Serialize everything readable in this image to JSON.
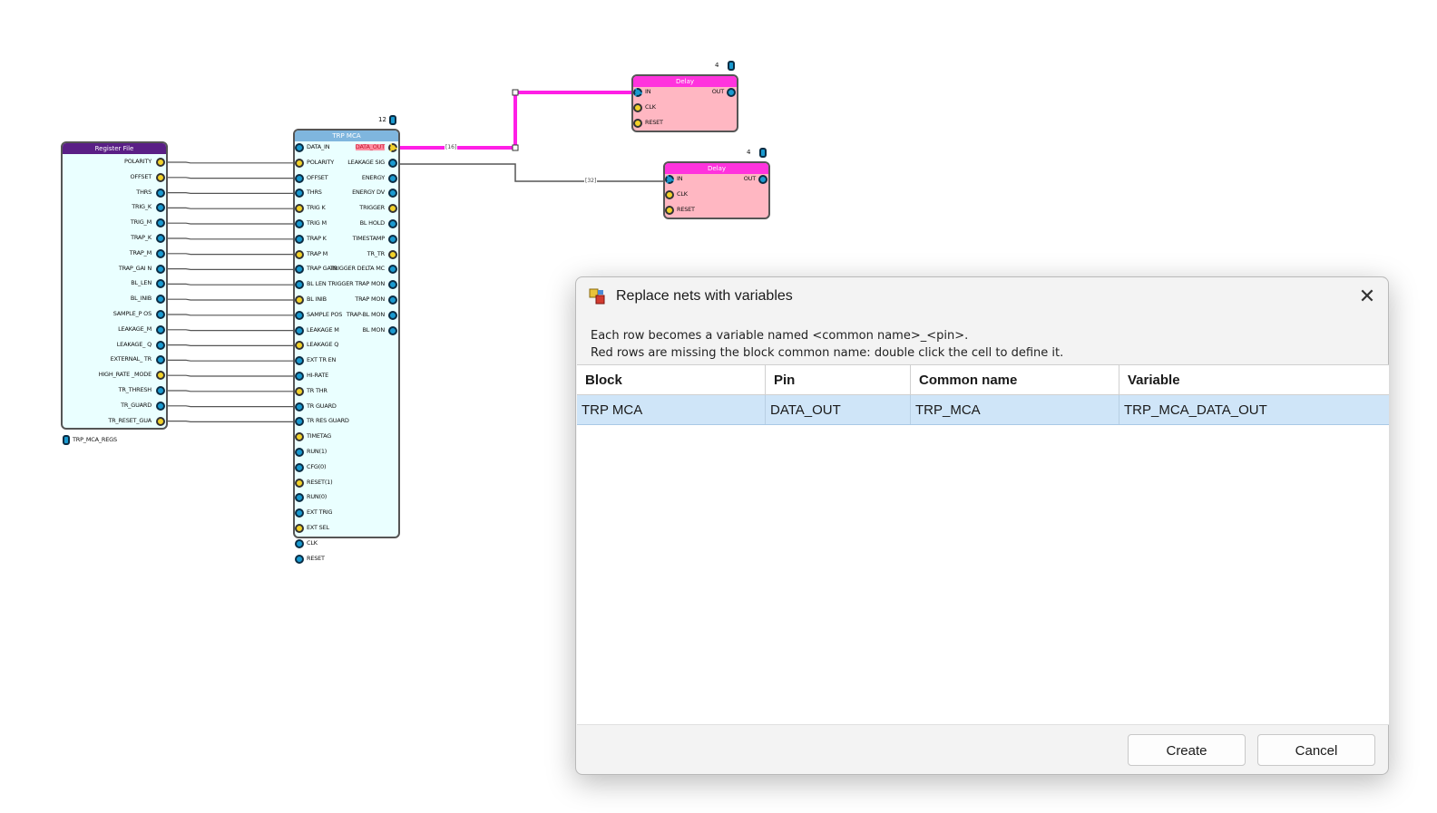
{
  "schematic": {
    "register_file": {
      "title": "Register File",
      "pins": [
        "POLARITY",
        "OFFSET",
        "THRS",
        "TRIG_K",
        "TRIG_M",
        "TRAP_K",
        "TRAP_M",
        "TRAP_GAI N",
        "BL_LEN",
        "BL_INIB",
        "SAMPLE_P OS",
        "LEAKAGE_M",
        "LEAKAGE_ Q",
        "EXTERNAL_ TR",
        "HIGH_RATE _MODE",
        "TR_THRESH",
        "TR_GUARD",
        "TR_RESET_GUA"
      ],
      "name": "TRP_MCA_REGS"
    },
    "mca": {
      "title": "TRP MCA",
      "count": "12",
      "inputs": [
        "DATA_IN",
        "POLARITY",
        "OFFSET",
        "THRS",
        "TRIG K",
        "TRIG M",
        "TRAP K",
        "TRAP M",
        "TRAP GAIN",
        "BL LEN",
        "BL INIB",
        "SAMPLE POS",
        "LEAKAGE M",
        "LEAKAGE Q",
        "EXT TR EN",
        "HI-RATE",
        "TR THR",
        "TR GUARD",
        "TR RES GUARD",
        "TIMETAG",
        "RUN(1)",
        "CFG(0)",
        "RESET(1)",
        "RUN(0)",
        "EXT TRIG",
        "EXT SEL",
        "CLK",
        "RESET"
      ],
      "outputs": [
        "DATA_OUT",
        "LEAKAGE SIG",
        "ENERGY",
        "ENERGY DV",
        "TRIGGER",
        "BL HOLD",
        "TIMESTAMP",
        "TR_TR",
        "TRIGGER DELTA MC",
        "TRIGGER TRAP MON",
        "TRAP MON",
        "TRAP-BL MON",
        "BL MON"
      ]
    },
    "delay1": {
      "title": "Delay",
      "count": "4",
      "pins": [
        "IN",
        "CLK",
        "RESET"
      ],
      "out": "OUT"
    },
    "delay2": {
      "title": "Delay",
      "count": "4",
      "pins": [
        "IN",
        "CLK",
        "RESET"
      ],
      "out": "OUT"
    },
    "bus_labels": {
      "data_out": "[16]",
      "leakage": "[32]"
    }
  },
  "dialog": {
    "title": "Replace nets with variables",
    "description_line1": "Each row becomes a variable named <common name>_<pin>.",
    "description_line2": "Red rows are missing the block common name: double click the cell to define it.",
    "columns": [
      "Block",
      "Pin",
      "Common name",
      "Variable"
    ],
    "rows": [
      [
        "TRP MCA",
        "DATA_OUT",
        "TRP_MCA",
        "TRP_MCA_DATA_OUT"
      ]
    ],
    "create_label": "Create",
    "cancel_label": "Cancel",
    "close_label": "✕"
  },
  "colors": {
    "register_title": "#5a1f86",
    "mca_title": "#7fb6de",
    "delay_title": "#ff33dd",
    "delay_body": "#ffb7c2",
    "block_body": "#eaffff",
    "highlight_wire": "#ff1ee6"
  }
}
